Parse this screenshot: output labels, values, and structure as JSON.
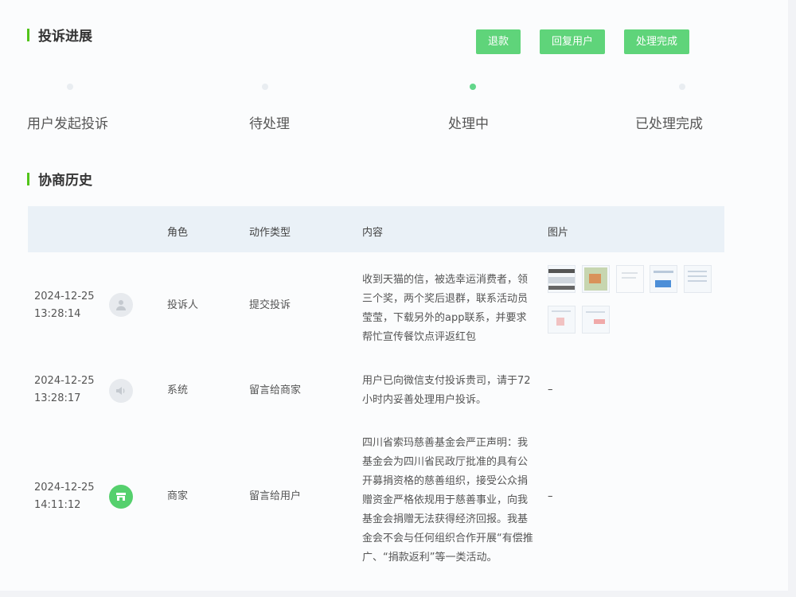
{
  "progress": {
    "title": "投诉进展",
    "buttons": {
      "refund": "退款",
      "reply": "回复用户",
      "done": "处理完成"
    },
    "steps": [
      "用户发起投诉",
      "待处理",
      "处理中",
      "已处理完成"
    ],
    "active_step": 2
  },
  "history": {
    "title": "协商历史",
    "columns": [
      "角色",
      "动作类型",
      "内容",
      "图片"
    ],
    "rows": [
      {
        "date": "2024-12-25",
        "time": "13:28:14",
        "role": "投诉人",
        "action": "提交投诉",
        "content_lines": [
          "收到天猫的信，被选幸运消费者，领",
          "三个奖，两个奖后退群，联系活动员",
          "莹莹，下载另外的app联系，并要求",
          "帮忙宣传餐饮点评返红包"
        ],
        "images": [
          "screenshot-thumb",
          "photo-thumb",
          "doc-thumb",
          "app-thumb",
          "form-thumb",
          "chat-thumb",
          "receipt-thumb"
        ],
        "avatar_icon": "person-icon"
      },
      {
        "date": "2024-12-25",
        "time": "13:28:17",
        "role": "系统",
        "action": "留言给商家",
        "content_lines": [
          "用户已向微信支付投诉贵司，请于72",
          "小时内妥善处理用户投诉。"
        ],
        "images_text": "–",
        "avatar_icon": "speaker-icon"
      },
      {
        "date": "2024-12-25",
        "time": "14:11:12",
        "role": "商家",
        "action": "留言给用户",
        "content_lines": [
          "四川省索玛慈善基金会严正声明：我",
          "基金会为四川省民政厅批准的具有公",
          "开募捐资格的慈善组织，接受公众捐",
          "赠资金严格依规用于慈善事业，向我",
          "基金会捐赠无法获得经济回报。我基",
          "金会不会与任何组织合作开展“有偿推",
          "广、“捐款返利”等一类活动。"
        ],
        "images_text": "–",
        "avatar_icon": "store-icon"
      }
    ]
  }
}
